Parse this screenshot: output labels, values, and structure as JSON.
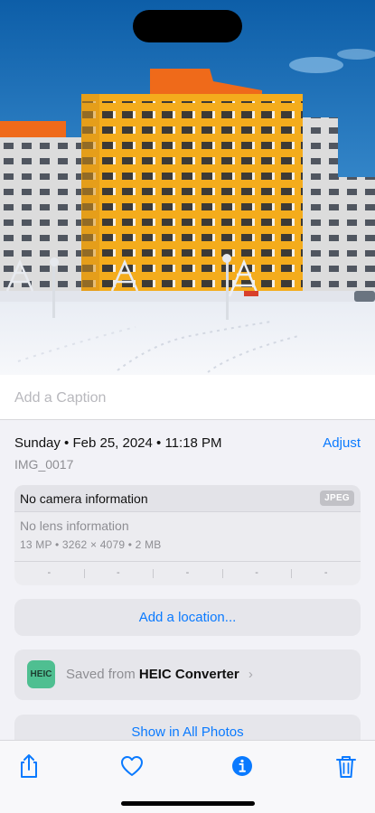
{
  "photo": {
    "description_icon": "photo-image",
    "colors": {
      "sky_top": "#0d5ea8",
      "sky_bottom": "#5aa6db",
      "building_yellow": "#f4ac1c",
      "building_orange": "#ef6a1a",
      "snow": "#f1f3f8"
    }
  },
  "caption": {
    "placeholder": "Add a Caption"
  },
  "info": {
    "datetime": "Sunday • Feb 25, 2024 • 11:18 PM",
    "adjust_label": "Adjust",
    "filename": "IMG_0017"
  },
  "camera": {
    "title": "No camera information",
    "format_badge": "JPEG",
    "lens": "No lens information",
    "specs": "13 MP  •  3262 × 4079  •  2 MB",
    "exif": [
      "-",
      "-",
      "-",
      "-",
      "-"
    ]
  },
  "location": {
    "label": "Add a location..."
  },
  "saved_from": {
    "app_icon_text": "HEIC",
    "prefix": "Saved from",
    "app_name": "HEIC Converter",
    "chevron": "›"
  },
  "show_all": {
    "label": "Show in All Photos"
  },
  "toolbar": {
    "icons": [
      "share-icon",
      "heart-icon",
      "info-icon",
      "trash-icon"
    ],
    "accent": "#0a7aff"
  }
}
